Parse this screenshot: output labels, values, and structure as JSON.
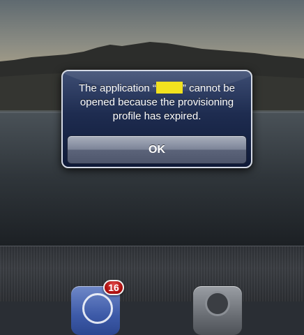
{
  "alert": {
    "message_before": "The application “",
    "message_after": "” cannot be opened because the provisioning profile has expired.",
    "ok_label": "OK",
    "redaction_color": "#f2e21f"
  },
  "dock": {
    "left_icon": {
      "name": "app-store-icon",
      "badge": "16"
    },
    "right_icon": {
      "name": "settings-icon"
    }
  }
}
